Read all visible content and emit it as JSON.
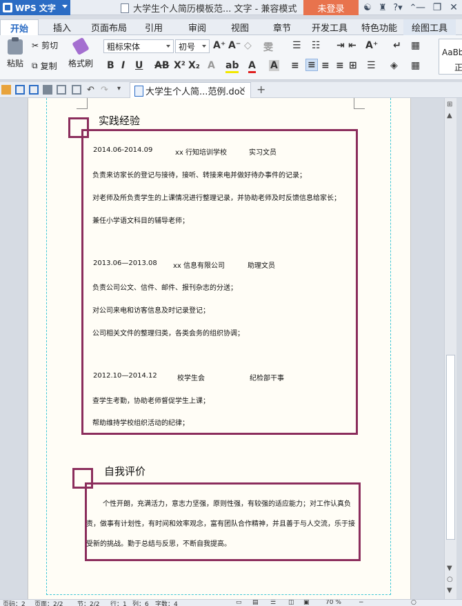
{
  "app": {
    "name": "WPS 文字"
  },
  "titlebar": {
    "document_title": "大学生个人简历模板范... 文字 - 兼容模式",
    "login_label": "未登录",
    "icons": [
      "skin-icon",
      "shirt-icon",
      "help-icon",
      "collapse-icon"
    ],
    "window_controls": [
      "minimize-icon",
      "restore-icon",
      "close-icon"
    ]
  },
  "menu": {
    "tabs": [
      "开始",
      "插入",
      "页面布局",
      "引用",
      "审阅",
      "视图",
      "章节",
      "开发工具",
      "特色功能",
      "绘图工具"
    ],
    "active": "开始"
  },
  "ribbon": {
    "paste_label": "粘贴",
    "cut_label": "剪切",
    "copy_label": "复制",
    "format_painter_label": "格式刷",
    "font_name": "粗标宋体",
    "font_size": "初号",
    "style_preview": "AaBb",
    "style_name": "正"
  },
  "doc_tab": {
    "label": "大学生个人简...范例.doc",
    "close": "×",
    "add": "+"
  },
  "document": {
    "experience": {
      "title": "实践经验",
      "entries": [
        {
          "period": "2014.06-2014.09",
          "org": "xx 行知培训学校",
          "role": "实习文员",
          "lines": [
            "负责来访家长的登记与接待，接听、转接来电并做好待办事件的记录；",
            "对老师及所负责学生的上课情况进行整理记录，并协助老师及时反馈信息给家长；",
            "兼任小学语文科目的辅导老师；"
          ]
        },
        {
          "period": "2013.06—2013.08",
          "org": "xx 信息有限公司",
          "role": "助理文员",
          "lines": [
            "负责公司公文、信件、邮件、报刊杂志的分送；",
            "对公司来电和访客信息及时记录登记；",
            "公司相关文件的整理归类，各类会务的组织协调；"
          ]
        },
        {
          "period": "2012.10—2014.12",
          "org": "校学生会",
          "role": "纪检部干事",
          "lines": [
            "查学生考勤，协助老师督促学生上课；",
            "帮助维持学校组织活动的纪律；"
          ]
        }
      ]
    },
    "self_eval": {
      "title": "自我评价",
      "text": "个性开朗，充满活力，意志力坚强，原则性强，有较强的适应能力；对工作认真负责，做事有计划性，有时间和效率观念，富有团队合作精神，并且善于与人交流，乐于接受新的挑战。勤于总结与反思，不断自我提高。"
    }
  },
  "statusbar": {
    "page": "页码：2",
    "pages": "页面：2/2",
    "section": "节：2/2",
    "row": "行：1",
    "col": "列：6",
    "words": "字数：4",
    "zoom": "70 %"
  },
  "colors": {
    "accent_box": "#8b2d5c",
    "brand": "#2b6cc4",
    "login": "#e8734d"
  }
}
